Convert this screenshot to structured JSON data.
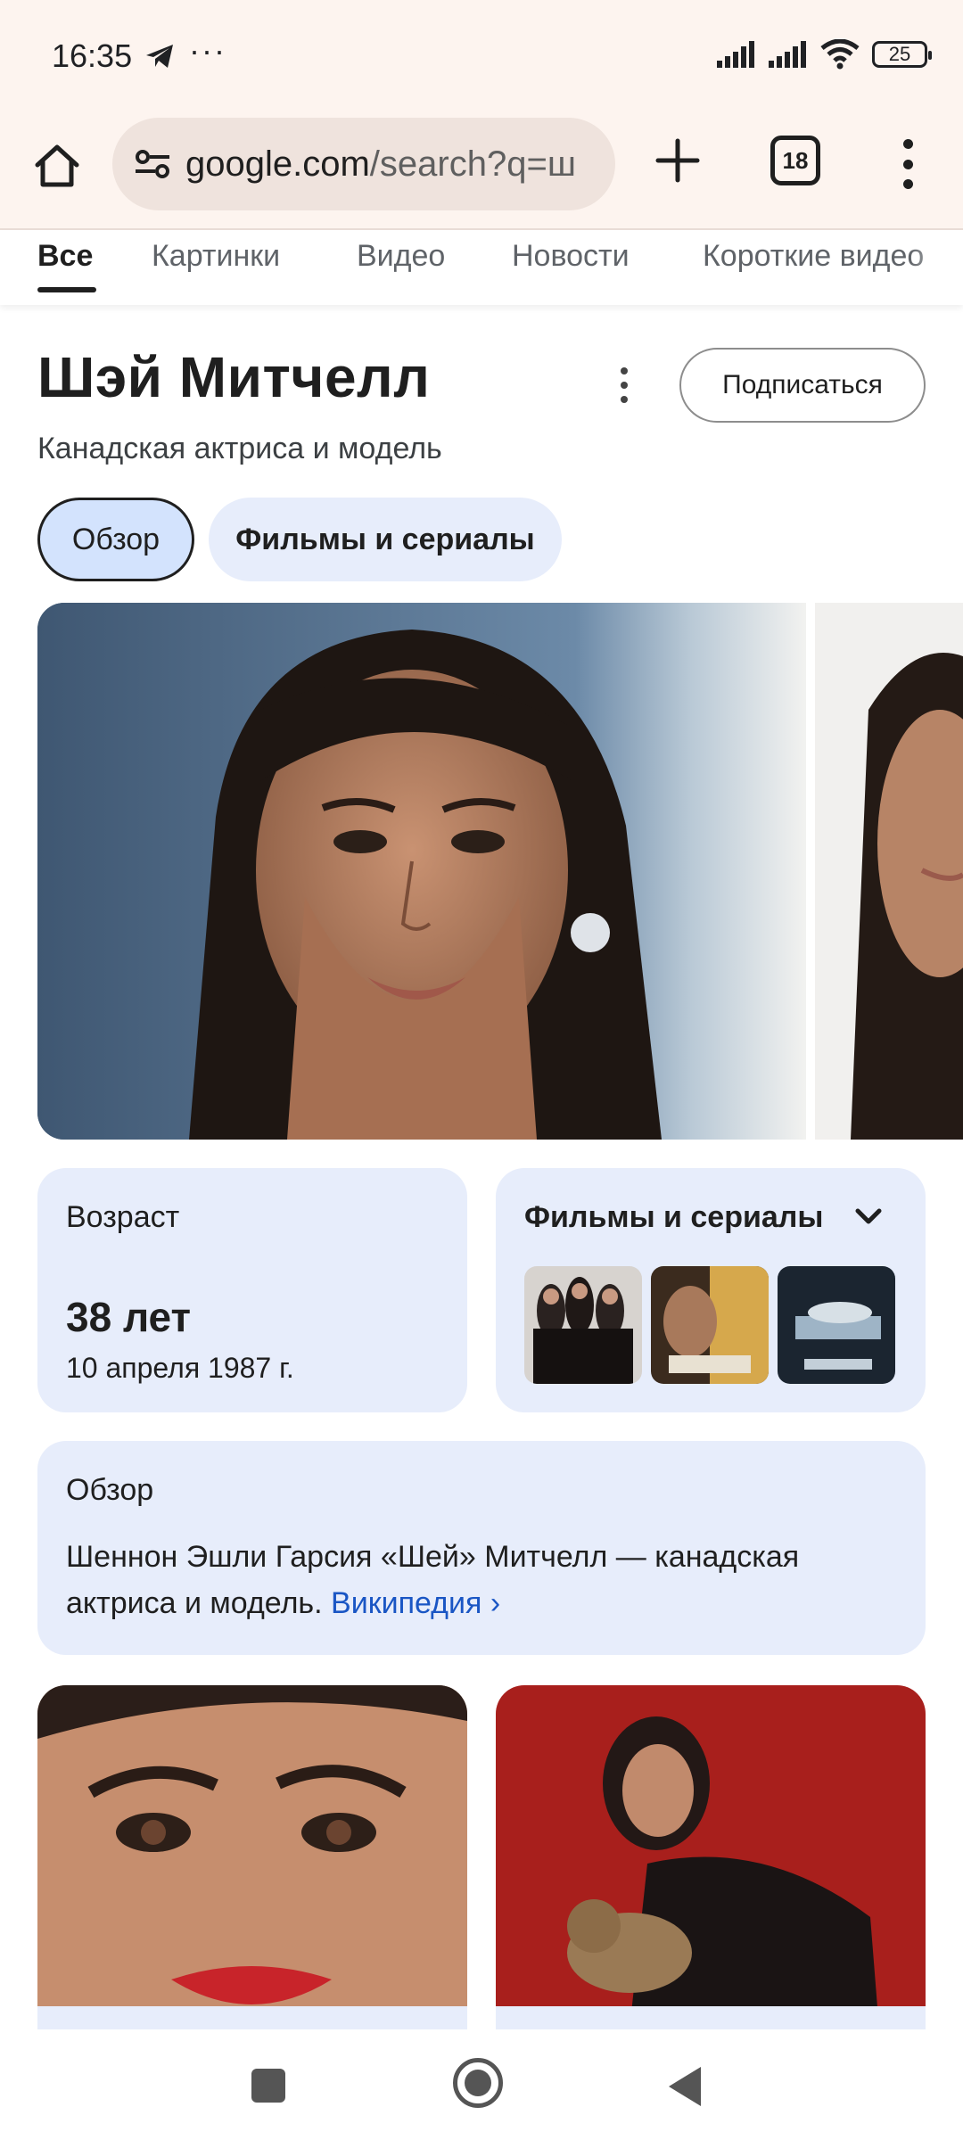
{
  "status_bar": {
    "time": "16:35",
    "dots": "···",
    "battery": "25"
  },
  "browser": {
    "url_host": "google.com",
    "url_path": "/search?q=ш",
    "tab_count": "18"
  },
  "filter_tabs": [
    "Все",
    "Картинки",
    "Видео",
    "Новости",
    "Короткие видео"
  ],
  "entity": {
    "name": "Шэй Митчелл",
    "description": "Канадская актриса и модель",
    "subscribe_label": "Подписаться"
  },
  "chips": {
    "overview": "Обзор",
    "films": "Фильмы и сериалы"
  },
  "age_card": {
    "label": "Возраст",
    "value": "38 лет",
    "birth_date": "10 апреля 1987 г."
  },
  "films_card": {
    "title": "Фильмы и сериалы",
    "posters": [
      "poster-pretty-little-liars",
      "poster-you",
      "poster-cadaver"
    ]
  },
  "overview_card": {
    "title": "Обзор",
    "text": "Шеннон Эшли Гарсия «Шей» Митчелл — канадская актриса и модель.",
    "link": "Википедия"
  },
  "colors": {
    "chrome_bg": "#fdf4ef",
    "card_bg": "#e7edfb",
    "chip_active": "#d3e3fd",
    "link": "#1a56c4"
  }
}
